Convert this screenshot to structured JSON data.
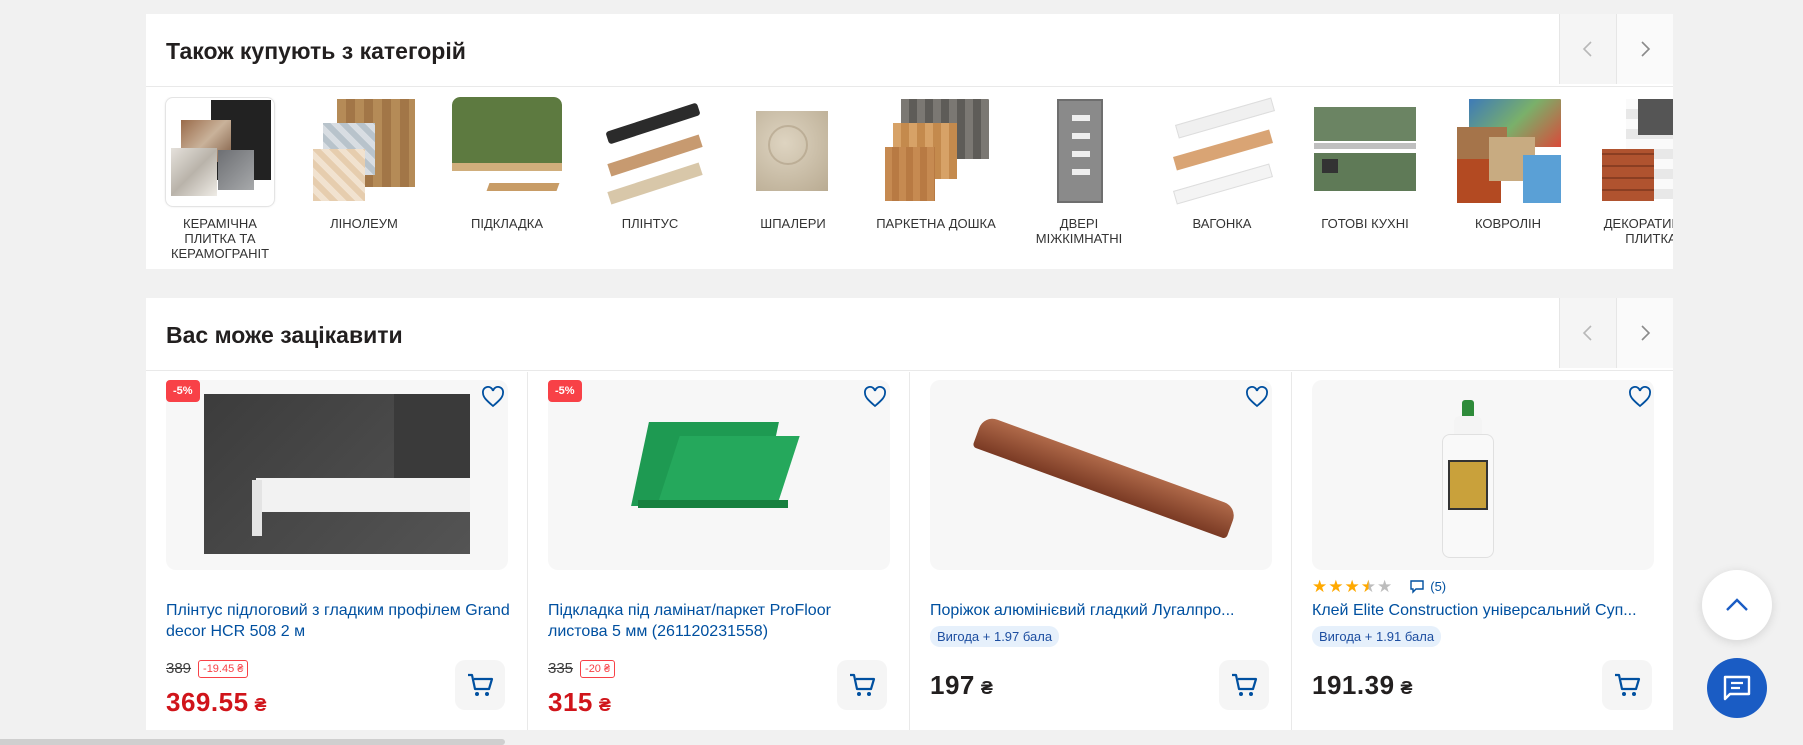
{
  "categories_section": {
    "title": "Також купують з категорій",
    "items": [
      {
        "label": "Керамічна плитка та керамограніт",
        "icon": "ceramic-tile-image"
      },
      {
        "label": "Лінолеум",
        "icon": "linoleum-image"
      },
      {
        "label": "Підкладка",
        "icon": "underlay-image"
      },
      {
        "label": "Плінтус",
        "icon": "plinth-image"
      },
      {
        "label": "Шпалери",
        "icon": "wallpaper-image"
      },
      {
        "label": "Паркетна дошка",
        "icon": "parquet-image"
      },
      {
        "label": "Двері міжкімнатні",
        "icon": "interior-door-image"
      },
      {
        "label": "Вагонка",
        "icon": "lining-board-image"
      },
      {
        "label": "Готові кухні",
        "icon": "kitchen-image"
      },
      {
        "label": "Ковролін",
        "icon": "carpet-image"
      },
      {
        "label": "Декоративна плитка",
        "icon": "decorative-tile-image"
      }
    ]
  },
  "recommend_section": {
    "title": "Вас може зацікавити",
    "products": [
      {
        "badge": "-5%",
        "title": "Плінтус підлоговий з гладким профілем Grand decor HCR 508 2 м",
        "old_price": "389",
        "discount": "-19.45 ₴",
        "price": "369.55",
        "currency": "₴",
        "image": "white-plinth-image"
      },
      {
        "badge": "-5%",
        "title": "Підкладка під ламінат/паркет ProFloor листова 5 мм (261120231558)",
        "old_price": "335",
        "discount": "-20 ₴",
        "price": "315",
        "currency": "₴",
        "image": "green-underlay-image"
      },
      {
        "title": "Поріжок алюмінієвий гладкий Лугалпро...",
        "bonus": "Вигода + 1.97 бала",
        "price": "197",
        "currency": "₴",
        "image": "aluminium-threshold-image"
      },
      {
        "title": "Клей Elite Construction універсальний Суп...",
        "bonus": "Вигода + 1.91 бала",
        "price": "191.39",
        "currency": "₴",
        "rating": 3.5,
        "reviews": "(5)",
        "image": "glue-bottle-image"
      }
    ]
  },
  "colors": {
    "link": "#0050a0",
    "sale_red": "#d0141a",
    "badge_red": "#f84147",
    "chat_blue": "#1a5cc4",
    "star": "#ffa900"
  }
}
